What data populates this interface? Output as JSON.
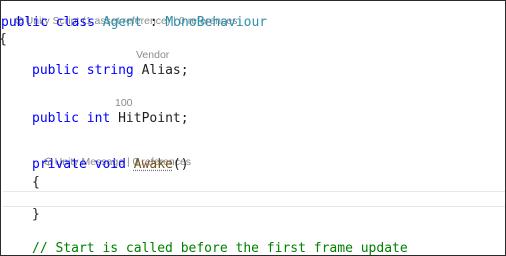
{
  "colors": {
    "keyword": "#0000ff",
    "type": "#2b91af",
    "method": "#74531f",
    "comment": "#008000",
    "codelens": "#8a8a8a"
  },
  "codelens": {
    "class_info": "Unity Script (1 asset reference) | 0 references",
    "alias_hint": "Vendor",
    "hitpoint_hint": "100",
    "awake_info": "Unity Message | 0 references",
    "class_icon": "unity-icon",
    "awake_icon": "unity-message-icon"
  },
  "code": {
    "l1_public": "public",
    "l1_class": "class",
    "l1_name": "Agent",
    "l1_colon": " : ",
    "l1_base": "MonoBehaviour",
    "l2_brace": "{",
    "alias_public": "public",
    "alias_type": "string",
    "alias_name": "Alias;",
    "hp_public": "public",
    "hp_type": "int",
    "hp_name": "HitPoint;",
    "awake_private": "private",
    "awake_void": "void",
    "awake_name": "Awake",
    "awake_parens": "()",
    "awake_open": "{",
    "awake_close": "}",
    "comment": "// Start is called before the first frame update"
  }
}
